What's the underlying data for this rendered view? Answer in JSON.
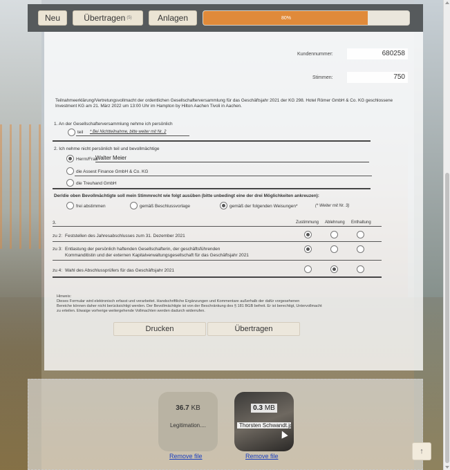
{
  "toolbar": {
    "new_label": "Neu",
    "transfer_label": "Übertragen",
    "transfer_count": "(5)",
    "attachments_label": "Anlagen",
    "progress_text": "80%",
    "progress_value": 80
  },
  "form": {
    "customer_number_label": "Kundennummer:",
    "customer_number_value": "680258",
    "votes_label": "Stimmen:",
    "votes_value": "750",
    "intro": "Teilnahmeerklärung/Vertretungsvollmacht der ordentlichen Gesellschafterversammlung für das Geschäftsjahr 2021 der KG 298. Hotel Römer GmbH & Co. KG geschlossene Investment KG am 21. März 2022 um 13:00 Uhr im Hampton by Hilton Aachen Tivoli in Aachen.",
    "section1_title": "1. An der Gesellschafterversammlung nehme ich persönlich",
    "section1_option": "teil",
    "section1_hint": "* Bei Nichtteilnahme, bitte weiter mit Nr. 2",
    "section2_title": "2. Ich nehme nicht persönlich teil und bevollmächtige",
    "proxy_person_label": "Herrn/Frau",
    "proxy_person_value": "Walter Meier",
    "proxy_option2": "die Assest Finance GmbH & Co. KG",
    "proxy_option3": "die Treuhand GmbH",
    "voting_title": "Der/die oben Bevollmächtigte soll mein Stimmrecht wie folgt ausüben (bitte unbedingt eine der drei Möglichkeiten ankreuzen):",
    "voting_option1": "frei abstimmen",
    "voting_option2": "gemäß Beschlussvorlage",
    "voting_option3": "gemäß der folgenden Weisungen*",
    "voting_hint": "(* Weiter mit Nr. 3)",
    "section3_title": "3.",
    "col_yes": "Zustimmung",
    "col_no": "Ablehnung",
    "col_abstain": "Enthaltung",
    "item1_num": "zu 2:",
    "item1_text": "Feststellen des Jahresabschlusses zum 31. Dezember 2021",
    "item2_num": "zu 3:",
    "item2_text_line1": "Entlastung der persönlich haftenden Gesellschafterin, der geschäftsführenden",
    "item2_text_line2": "Kommanditistin  und der externen Kapitalverwaltungsgesellschaft für das Geschäftsjahr 2021",
    "item3_num": "zu 4:",
    "item3_text": "Wahl des Abschlussprüfers für das Geschäftsjahr 2021",
    "note_title": "Hinweis:",
    "note_line1": "Dieses Formular wird elektronisch erfasst und verarbeitet. Handschriftliche Ergänzungen und Kommentare außerhalb der dafür vorgesehenen",
    "note_line2": "Bereiche  können daher nicht berücksichtigt werden. Der Bevollmächtigte ist von der Beschränkung des § 181 BGB befreit. Er ist berechtigt, Untervollmacht",
    "note_line3": "zu erteilen.  Etwaige vorherige weitergehende Vollmachten werden dadurch widerrufen.",
    "print_label": "Drucken",
    "submit_label": "Übertragen"
  },
  "uploads": [
    {
      "size_num": "36.7",
      "size_unit": "KB",
      "name": "Legitimation....",
      "remove": "Remove file"
    },
    {
      "size_num": "0.3",
      "size_unit": "MB",
      "name": "Thorsten Schwandt.jpg",
      "remove": "Remove file"
    }
  ],
  "scroll_top_icon": "↑"
}
